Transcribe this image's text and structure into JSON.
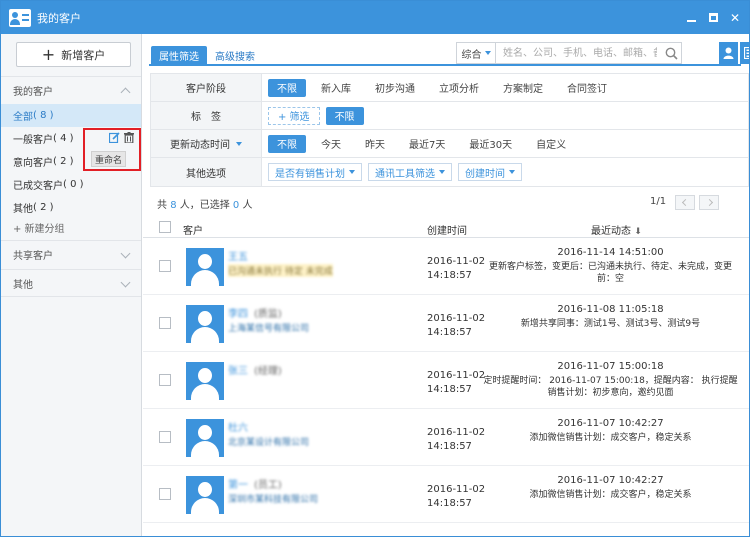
{
  "window": {
    "title": "我的客户"
  },
  "sidebar": {
    "new_button": "新增客户",
    "sections": {
      "mine": "我的客户",
      "shared": "共享客户",
      "other": "其他"
    },
    "items": [
      {
        "label": "全部",
        "count": "( 8 )"
      },
      {
        "label": "一般客户",
        "count": "( 4 )"
      },
      {
        "label": "意向客户",
        "count": "( 2 )"
      },
      {
        "label": "已成交客户",
        "count": "( 0 )"
      },
      {
        "label": "其他",
        "count": "( 2 )"
      }
    ],
    "add_group": "+ 新建分组",
    "rename_tip": "重命名"
  },
  "search": {
    "tabs": [
      "属性筛选",
      "高级搜索"
    ],
    "combo": "综合",
    "placeholder": "姓名、公司、手机、电话、邮箱、备注"
  },
  "filters": {
    "stage": {
      "label": "客户阶段",
      "options": [
        "不限",
        "新入库",
        "初步沟通",
        "立项分析",
        "方案制定",
        "合同签订"
      ]
    },
    "tags": {
      "label": "标　签",
      "add": "+ 筛选",
      "active": "不限"
    },
    "updated": {
      "label": "更新动态时间",
      "options": [
        "不限",
        "今天",
        "昨天",
        "最近7天",
        "最近30天",
        "自定义"
      ]
    },
    "other": {
      "label": "其他选项",
      "dropdowns": [
        "是否有销售计划",
        "通讯工具筛选",
        "创建时间"
      ]
    }
  },
  "summary": {
    "pre": "共 ",
    "total": "8",
    "mid": " 人，已选择 ",
    "selected": "0",
    "post": " 人"
  },
  "pager": {
    "text": "1/1"
  },
  "table": {
    "headers": {
      "customer": "客户",
      "created": "创建时间",
      "latest": "最近动态"
    },
    "rows": [
      {
        "name": "王五",
        "name_suffix": "",
        "sub": "已沟通未执行  待定  未完成",
        "sub_highlight": true,
        "created_date": "2016-11-02",
        "created_time": "14:18:57",
        "latest_time": "2016-11-14 14:51:00",
        "latest_text": "更新客户标签，变更后：已沟通未执行、待定、未完成，变更前：空"
      },
      {
        "name": "李四",
        "name_suffix": "(质监)",
        "sub": "上海某信号有限公司",
        "sub_highlight": false,
        "created_date": "2016-11-02",
        "created_time": "14:18:57",
        "latest_time": "2016-11-08 11:05:18",
        "latest_text": "新增共享同事：测试1号、测试3号、测试9号"
      },
      {
        "name": "张三",
        "name_suffix": "(经理)",
        "sub": "",
        "sub_highlight": false,
        "created_date": "2016-11-02",
        "created_time": "14:18:57",
        "latest_time": "2016-11-07 15:00:18",
        "latest_text": "定时提醒时间： 2016-11-07 15:00:18，提醒内容： 执行提醒销售计划：初步意向，邀约见面"
      },
      {
        "name": "杜六",
        "name_suffix": "",
        "sub": "北京某设计有限公司",
        "sub_highlight": false,
        "created_date": "2016-11-02",
        "created_time": "14:18:57",
        "latest_time": "2016-11-07 10:42:27",
        "latest_text": "添加微信销售计划：成交客户，稳定关系"
      },
      {
        "name": "第一",
        "name_suffix": "(员工)",
        "sub": "深圳市某科技有限公司",
        "sub_highlight": false,
        "created_date": "2016-11-02",
        "created_time": "14:18:57",
        "latest_time": "2016-11-07 10:42:27",
        "latest_text": "添加微信销售计划：成交客户，稳定关系"
      }
    ]
  },
  "colors": {
    "accent": "#3c93dc",
    "highlight_box": "#e21f26",
    "active_item_bg": "#d4e8f8"
  }
}
